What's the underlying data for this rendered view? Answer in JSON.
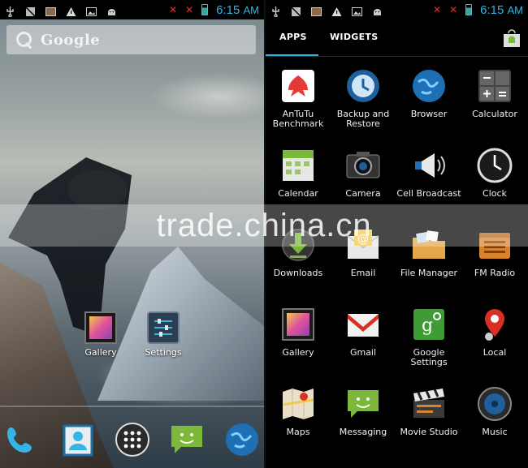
{
  "status_left": {
    "time": "6:15",
    "ampm": "AM"
  },
  "status_right": {
    "time": "6:15",
    "ampm": "AM"
  },
  "search": {
    "label": "Google"
  },
  "home_shortcuts": [
    {
      "label": "Gallery",
      "icon": "gallery-icon"
    },
    {
      "label": "Settings",
      "icon": "settings-icon"
    }
  ],
  "hotseat": [
    "phone-icon",
    "contacts-icon",
    "app-drawer-icon",
    "messaging-icon",
    "browser-icon"
  ],
  "tabs": {
    "apps": "APPS",
    "widgets": "WIDGETS"
  },
  "apps": [
    {
      "label": "AnTuTu Benchmark",
      "icon": "antutu-icon"
    },
    {
      "label": "Backup and Restore",
      "icon": "backup-icon"
    },
    {
      "label": "Browser",
      "icon": "browser-icon"
    },
    {
      "label": "Calculator",
      "icon": "calculator-icon"
    },
    {
      "label": "Calendar",
      "icon": "calendar-icon"
    },
    {
      "label": "Camera",
      "icon": "camera-icon"
    },
    {
      "label": "Cell Broadcast",
      "icon": "cell-broadcast-icon"
    },
    {
      "label": "Clock",
      "icon": "clock-icon"
    },
    {
      "label": "Downloads",
      "icon": "downloads-icon"
    },
    {
      "label": "Email",
      "icon": "email-icon"
    },
    {
      "label": "File Manager",
      "icon": "file-manager-icon"
    },
    {
      "label": "FM Radio",
      "icon": "fm-radio-icon"
    },
    {
      "label": "Gallery",
      "icon": "gallery-icon"
    },
    {
      "label": "Gmail",
      "icon": "gmail-icon"
    },
    {
      "label": "Google Settings",
      "icon": "google-settings-icon"
    },
    {
      "label": "Local",
      "icon": "local-icon"
    },
    {
      "label": "Maps",
      "icon": "maps-icon"
    },
    {
      "label": "Messaging",
      "icon": "messaging-icon"
    },
    {
      "label": "Movie Studio",
      "icon": "movie-studio-icon"
    },
    {
      "label": "Music",
      "icon": "music-icon"
    }
  ],
  "watermark": "trade.china.cn",
  "colors": {
    "accent": "#33b5e5",
    "background": "#000000"
  }
}
